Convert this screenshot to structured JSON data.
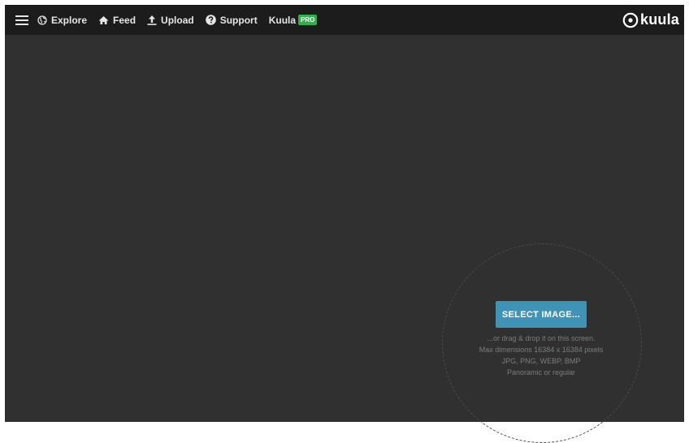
{
  "nav": {
    "menu_icon": "hamburger-icon",
    "items": [
      {
        "label": "Explore",
        "icon": "globe-icon"
      },
      {
        "label": "Feed",
        "icon": "home-icon"
      },
      {
        "label": "Upload",
        "icon": "upload-icon"
      },
      {
        "label": "Support",
        "icon": "help-icon"
      },
      {
        "label": "Kuula",
        "icon": ""
      }
    ],
    "pro_badge": "PRO",
    "pro_badge_color": "#2bb34a"
  },
  "logo": {
    "text": "kuula",
    "icon": "circle-dot-logo-icon"
  },
  "upload": {
    "button_label": "SELECT IMAGE...",
    "button_color": "#3e93b7",
    "hints": [
      "...or drag & drop it on this screen.",
      "Max dimensions 16384 x 16384 pixels",
      "JPG, PNG, WEBP, BMP",
      "Panoramic or regular"
    ]
  },
  "colors": {
    "background": "#303030",
    "topbar": "#1c1c1c"
  }
}
